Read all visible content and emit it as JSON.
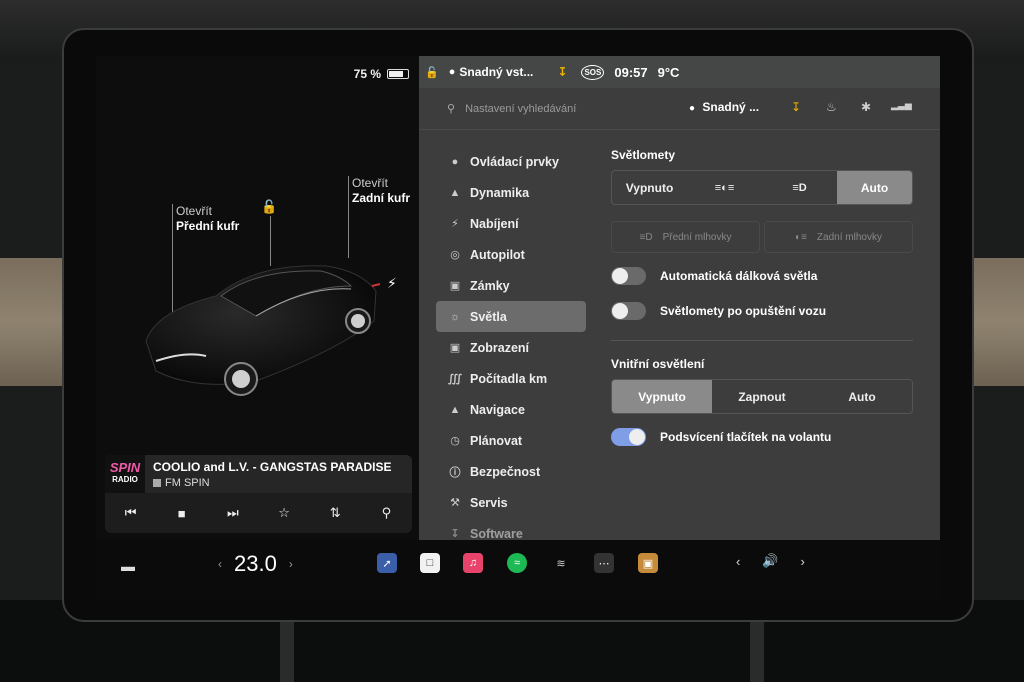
{
  "status": {
    "battery_percent": "75 %"
  },
  "car": {
    "front_trunk": {
      "action": "Otevřít",
      "name": "Přední kufr"
    },
    "rear_trunk": {
      "action": "Otevřít",
      "name": "Zadní kufr"
    }
  },
  "media": {
    "logo_top": "SPIN",
    "logo_bottom": "RADIO",
    "title": "COOLIO and L.V. - GANGSTAS PARADISE",
    "station": "FM SPIN"
  },
  "topbar": {
    "profile": "Snadný vst...",
    "sos": "SOS",
    "time": "09:57",
    "temp_out": "9°C"
  },
  "header": {
    "search_placeholder": "Nastavení vyhledávání",
    "profile": "Snadný ..."
  },
  "nav": {
    "items": [
      {
        "label": "Ovládací prvky",
        "icon": "toggle-icon"
      },
      {
        "label": "Dynamika",
        "icon": "car-icon"
      },
      {
        "label": "Nabíjení",
        "icon": "bolt-icon"
      },
      {
        "label": "Autopilot",
        "icon": "steering-wheel-icon"
      },
      {
        "label": "Zámky",
        "icon": "lock-icon"
      },
      {
        "label": "Světla",
        "icon": "sun-icon"
      },
      {
        "label": "Zobrazení",
        "icon": "display-icon"
      },
      {
        "label": "Počítadla km",
        "icon": "trip-icon"
      },
      {
        "label": "Navigace",
        "icon": "navigation-icon"
      },
      {
        "label": "Plánovat",
        "icon": "clock-icon"
      },
      {
        "label": "Bezpečnost",
        "icon": "shield-icon"
      },
      {
        "label": "Servis",
        "icon": "wrench-icon"
      },
      {
        "label": "Software",
        "icon": "download-icon"
      }
    ],
    "active_index": 5
  },
  "headlights": {
    "title": "Světlomety",
    "options": [
      "Vypnuto",
      "",
      "",
      "Auto"
    ],
    "selected": "Auto",
    "fog_front": "Přední mlhovky",
    "fog_rear": "Zadní mlhovky",
    "auto_high_beam": "Automatická dálková světla",
    "after_exit": "Světlomety po opuštění vozu"
  },
  "interior": {
    "title": "Vnitřní osvětlení",
    "options": [
      "Vypnuto",
      "Zapnout",
      "Auto"
    ],
    "selected": "Vypnuto",
    "steering_backlight": "Podsvícení tlačítek na volantu"
  },
  "bottom": {
    "cabin_temp": "23.0"
  },
  "colors": {
    "panel_bg": "#3d3d3d",
    "toggle_on": "#7f9ee6",
    "selected_segment": "#8a8a8a"
  }
}
